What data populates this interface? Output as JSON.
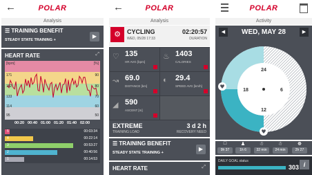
{
  "screen1": {
    "logo": "POLAR",
    "subtitle": "Analysis",
    "training_benefit": {
      "title": "TRAINING BENEFIT",
      "value": "STEADY STATE TRAINING +"
    },
    "heart_rate": {
      "title": "HEART RATE",
      "unit_left": "[bpm]",
      "unit_right": "[%]",
      "y_left": [
        "171",
        "152",
        "133",
        "114",
        "95"
      ],
      "y_right": [
        "90",
        "80",
        "70",
        "60",
        "50"
      ],
      "times": [
        "00:20",
        "00:40",
        "01:00",
        "01:20",
        "01:40",
        "02:00"
      ]
    },
    "zones": [
      {
        "num": "5",
        "time": "00:03:34",
        "color": "#e0507a",
        "fraction": 0.05
      },
      {
        "num": "4",
        "time": "00:22:14",
        "color": "#f2c84b",
        "fraction": 0.3
      },
      {
        "num": "3",
        "time": "00:53:27",
        "color": "#8fcf6a",
        "fraction": 0.72
      },
      {
        "num": "2",
        "time": "00:40:56",
        "color": "#4fb3cf",
        "fraction": 0.55
      },
      {
        "num": "1",
        "time": "00:14:53",
        "color": "#a9a9b3",
        "fraction": 0.2
      }
    ]
  },
  "screen2": {
    "logo": "POLAR",
    "subtitle": "Analysis",
    "sport": "CYCLING",
    "date": "WED, 05/28 17:33",
    "duration": "02:20:57",
    "duration_label": "DURATION",
    "metrics": [
      {
        "value": "135",
        "label": "HR AVG [bpm]",
        "icon": "heart-icon"
      },
      {
        "value": "1403",
        "label": "CALORIES",
        "icon": "flame-icon"
      },
      {
        "value": "69.0",
        "label": "DISTANCE [km]",
        "icon": "distance-icon"
      },
      {
        "value": "29.4",
        "label": "SPEED AVG [km/h]",
        "icon": "speedometer-icon"
      },
      {
        "value": "590",
        "label": "ASCENT [m]",
        "icon": "ascent-icon"
      }
    ],
    "training_load": {
      "value": "EXTREME",
      "label": "TRAINING LOAD"
    },
    "recovery": {
      "value": "3 d 2 h",
      "label": "RECOVERY NEED"
    },
    "training_benefit": {
      "title": "TRAINING BENEFIT",
      "value": "STEADY STATE TRAINING +"
    },
    "heart_rate_title": "HEART RATE"
  },
  "screen3": {
    "logo": "POLAR",
    "subtitle": "Activity",
    "day": "WED, MAY 28",
    "clock": [
      "24",
      "6",
      "18",
      "12"
    ],
    "activity_chips": [
      "9h 37",
      "1h 6",
      "32 min",
      "24 min",
      "2h 27"
    ],
    "goal_label": "DAILY GOAL status",
    "goal_percent": "303 %",
    "goal_fraction": 1.0
  },
  "colors": {
    "polar_red": "#d4002a",
    "teal": "#3bb3c3",
    "panel": "#4b4f57"
  }
}
